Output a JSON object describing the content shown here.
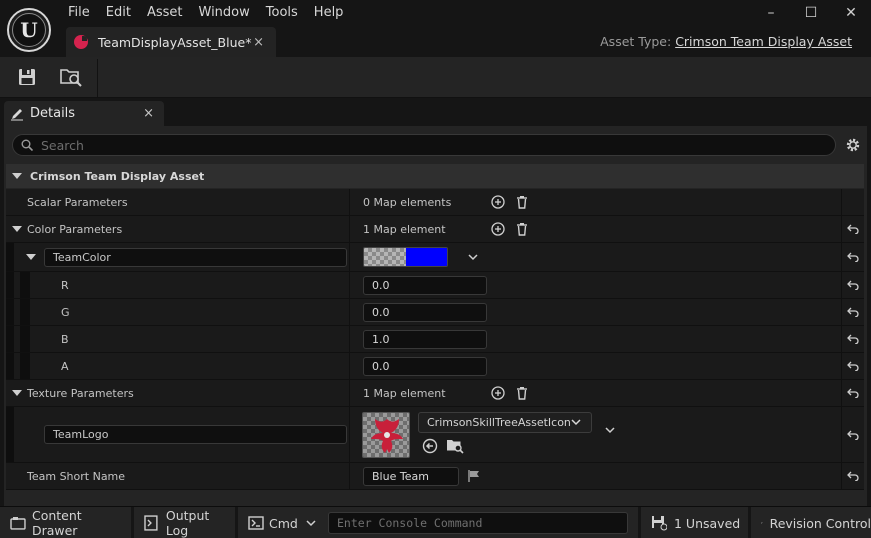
{
  "app": {
    "menu": [
      "File",
      "Edit",
      "Asset",
      "Window",
      "Tools",
      "Help"
    ],
    "window_controls": [
      "–",
      "☐",
      "✕"
    ],
    "doc_tab": {
      "label": "TeamDisplayAsset_Blue*",
      "close": "×"
    },
    "asset_type": {
      "label": "Asset Type:",
      "value": "Crimson Team Display Asset"
    }
  },
  "details": {
    "tab_label": "Details",
    "tab_close": "×",
    "search": {
      "placeholder": "Search",
      "value": ""
    },
    "category": "Crimson Team Display Asset",
    "scalar": {
      "label": "Scalar Parameters",
      "count": "0 Map elements"
    },
    "color": {
      "label": "Color Parameters",
      "count": "1 Map element",
      "key": "TeamColor",
      "swatch_color": "#0000ff",
      "channels": [
        {
          "name": "R",
          "value": "0.0"
        },
        {
          "name": "G",
          "value": "0.0"
        },
        {
          "name": "B",
          "value": "1.0"
        },
        {
          "name": "A",
          "value": "0.0"
        }
      ]
    },
    "texture": {
      "label": "Texture Parameters",
      "count": "1 Map element",
      "key": "TeamLogo",
      "asset": "CrimsonSkillTreeAssetIcon"
    },
    "short_name": {
      "label": "Team Short Name",
      "value": "Blue Team"
    }
  },
  "statusbar": {
    "content_drawer": "Content Drawer",
    "output_log": "Output Log",
    "cmd": "Cmd",
    "console_placeholder": "Enter Console Command",
    "unsaved": "1 Unsaved",
    "revision": "Revision Control"
  }
}
